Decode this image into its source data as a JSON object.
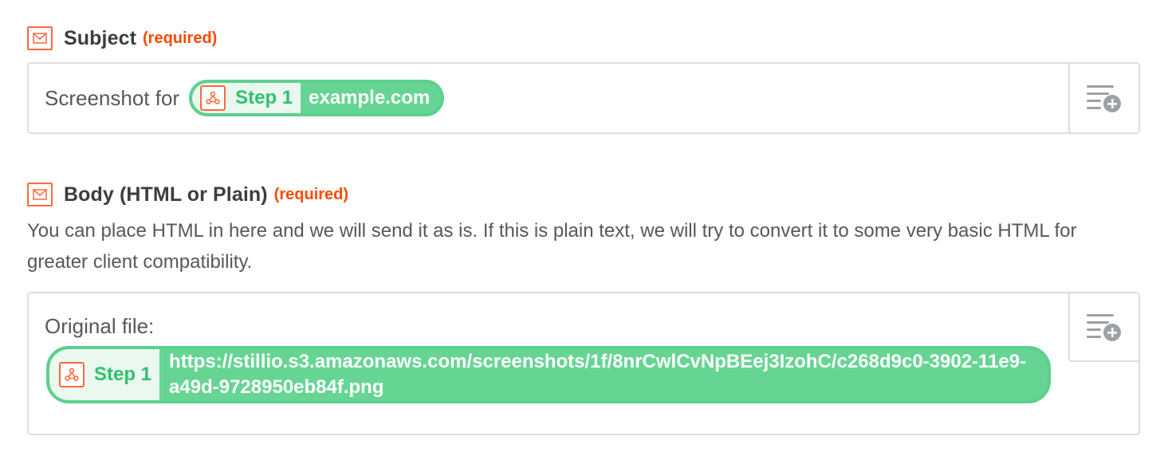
{
  "subject": {
    "label": "Subject",
    "required": "(required)",
    "prefix_text": "Screenshot for",
    "token": {
      "step": "Step 1",
      "value": "example.com"
    },
    "insert_icon": "list-add-icon"
  },
  "body": {
    "label": "Body (HTML or Plain)",
    "required": "(required)",
    "help_text": "You can place HTML in here and we will send it as is. If this is plain text, we will try to convert it to some very basic HTML for greater client compatibility.",
    "prefix_text": "Original file:",
    "token": {
      "step": "Step 1",
      "value": "https://stillio.s3.amazonaws.com/screenshots/1f/8nrCwlCvNpBEej3IzohC/c268d9c0-3902-11e9-a49d-9728950eb84f.png"
    },
    "insert_icon": "list-add-icon"
  },
  "colors": {
    "accent_orange": "#ff4a00",
    "pill_green": "#66d593",
    "step_green": "#2ec26e",
    "border": "#dbdcdd"
  }
}
